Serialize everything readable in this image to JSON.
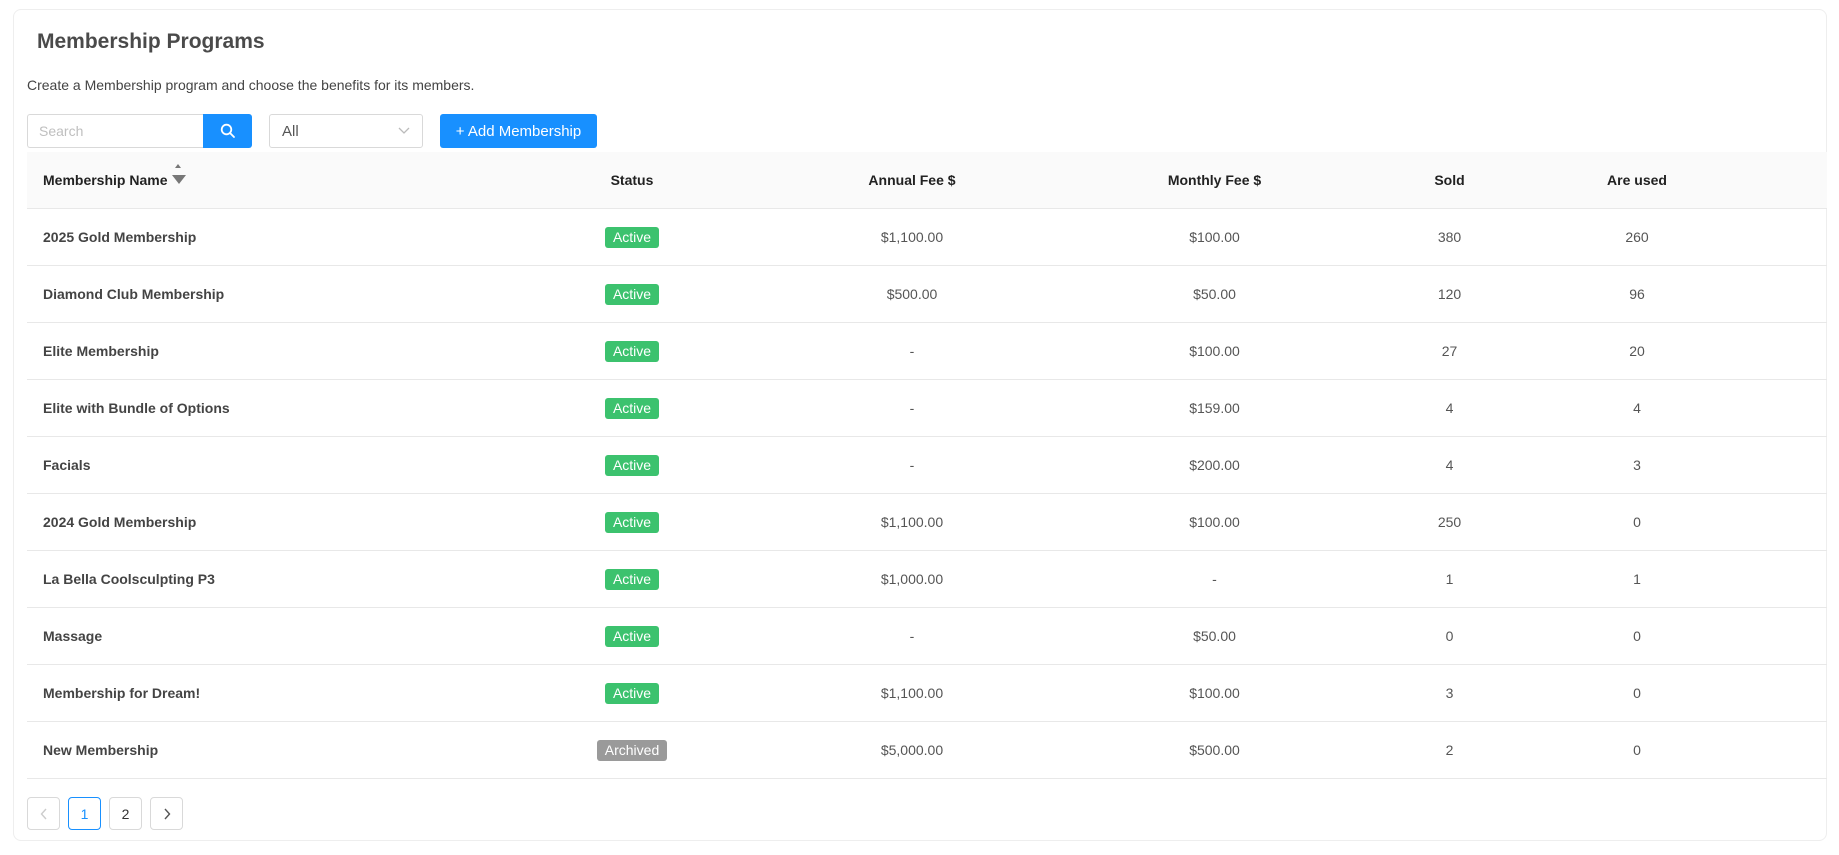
{
  "header": {
    "title": "Membership Programs",
    "subtitle": "Create a Membership program and choose the benefits for its members."
  },
  "toolbar": {
    "search_placeholder": "Search",
    "search_icon": "search-icon",
    "filter_value": "All",
    "add_label": "+ Add Membership"
  },
  "colors": {
    "primary": "#1890ff",
    "active": "#3cc26e",
    "archived": "#9a9a9a"
  },
  "table": {
    "columns": [
      "Membership Name",
      "Status",
      "Annual Fee $",
      "Monthly Fee $",
      "Sold",
      "Are used"
    ],
    "sort": {
      "column": "Membership Name",
      "direction": "descending"
    },
    "rows": [
      {
        "name": "2025 Gold Membership",
        "status": "Active",
        "annual": "$1,100.00",
        "monthly": "$100.00",
        "sold": "380",
        "used": "260"
      },
      {
        "name": "Diamond Club Membership",
        "status": "Active",
        "annual": "$500.00",
        "monthly": "$50.00",
        "sold": "120",
        "used": "96"
      },
      {
        "name": "Elite Membership",
        "status": "Active",
        "annual": "-",
        "monthly": "$100.00",
        "sold": "27",
        "used": "20"
      },
      {
        "name": "Elite with Bundle of Options",
        "status": "Active",
        "annual": "-",
        "monthly": "$159.00",
        "sold": "4",
        "used": "4"
      },
      {
        "name": "Facials",
        "status": "Active",
        "annual": "-",
        "monthly": "$200.00",
        "sold": "4",
        "used": "3"
      },
      {
        "name": "2024 Gold Membership",
        "status": "Active",
        "annual": "$1,100.00",
        "monthly": "$100.00",
        "sold": "250",
        "used": "0"
      },
      {
        "name": "La Bella Coolsculpting P3",
        "status": "Active",
        "annual": "$1,000.00",
        "monthly": "-",
        "sold": "1",
        "used": "1"
      },
      {
        "name": "Massage",
        "status": "Active",
        "annual": "-",
        "monthly": "$50.00",
        "sold": "0",
        "used": "0"
      },
      {
        "name": "Membership for Dream!",
        "status": "Active",
        "annual": "$1,100.00",
        "monthly": "$100.00",
        "sold": "3",
        "used": "0"
      },
      {
        "name": "New Membership",
        "status": "Archived",
        "annual": "$5,000.00",
        "monthly": "$500.00",
        "sold": "2",
        "used": "0"
      }
    ]
  },
  "pagination": {
    "prev_icon": "chevron-left-icon",
    "next_icon": "chevron-right-icon",
    "pages": [
      "1",
      "2"
    ],
    "current": "1"
  }
}
